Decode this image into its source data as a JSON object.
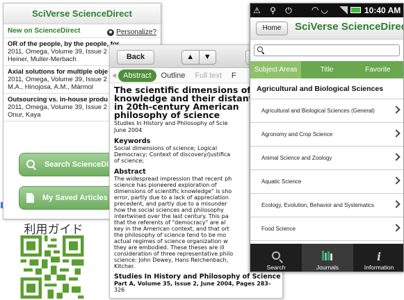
{
  "phone1": {
    "title": "SciVerse ScienceDirect",
    "section": "New on ScienceDirect",
    "personalize": "Personalize?",
    "articles": [
      {
        "title": "OR of the people, by the people, for...",
        "meta": "2011, Omega, Volume 39, Issue 2",
        "authors": "Heiner, Muller-Merbach"
      },
      {
        "title": "Axial solutions for multiple obje",
        "meta": "2011, Omega, Volume 39, Issue 2",
        "authors": "M.A., Hinojosa, A.M., Mármol"
      },
      {
        "title": "Outsourcing vs. in-house produ",
        "meta": "2011, Omega, Volume 39, Issue 2",
        "authors": "Onur, Kaya"
      }
    ],
    "search_button": "Search ScienceDire",
    "saved_button": "My Saved Articles"
  },
  "qr_label": "利用ガイド",
  "phone2": {
    "back": "Back",
    "up": "▲",
    "down": "▼",
    "tabs": [
      "Abstract",
      "Outline",
      "Full text",
      "F"
    ],
    "title_lines": [
      "The scientific dimensions of s",
      "knowledge and their distant (",
      "in 20th-century American",
      "philosophy of science"
    ],
    "source_lines": [
      "Studies In History and Philosophy of Scie",
      "June 2004"
    ],
    "keywords_heading": "Keywords",
    "keywords_lines": [
      "Social dimensions of science; Logical",
      "Democracy; Context of discovery/justifica",
      "of science;"
    ],
    "abstract_heading": "Abstract",
    "abstract_lines": [
      "The widespread impression that recent ph",
      "science has pioneered exploration of",
      "dimensions of scientific knowledge\" is sho",
      "error, partly due to a lack of appreciation",
      "precedent, and partly due to a misunder",
      "how the social sciences and philosophy",
      "intertwined over the last century. This pa",
      "that the referents of \"democracy\" are al",
      "key in the American context, and that ort",
      "the philosophy of science tend to be mo",
      "actual regimes of science organization w",
      "they are embodied. These theses are ill",
      "consideration of three representative philo",
      "science: John Dewey, Hans Reichenbach,",
      "Kitcher."
    ],
    "footer_lines": [
      "Studies In History and Philosophy of Science",
      "Part A, Volume 35, Issue 2, June 2004, Pages 283-",
      "326"
    ]
  },
  "phone3": {
    "status_left": "⚠ ⚲ ⏻",
    "time": "10:40 AM",
    "home": "Home",
    "logo": "SciVerse ScienceDirect",
    "tabs": [
      "Subject Areas",
      "Title",
      "Favorite"
    ],
    "category": "Agricultural and Biological Sciences",
    "items": [
      "Agricultural and Biological Sciences (General)",
      "Agronomy and Crop Science",
      "Animal Science and Zoology",
      "Aquatic Science",
      "Ecology, Evolution, Behavior and Systematics",
      "Food Science"
    ],
    "nav": [
      "Search",
      "Journals",
      "Information"
    ]
  },
  "colors": {
    "brand_green": "#2e7d32",
    "tab_green": "#6aa84f",
    "nav_dark": "#1e1e1e"
  }
}
